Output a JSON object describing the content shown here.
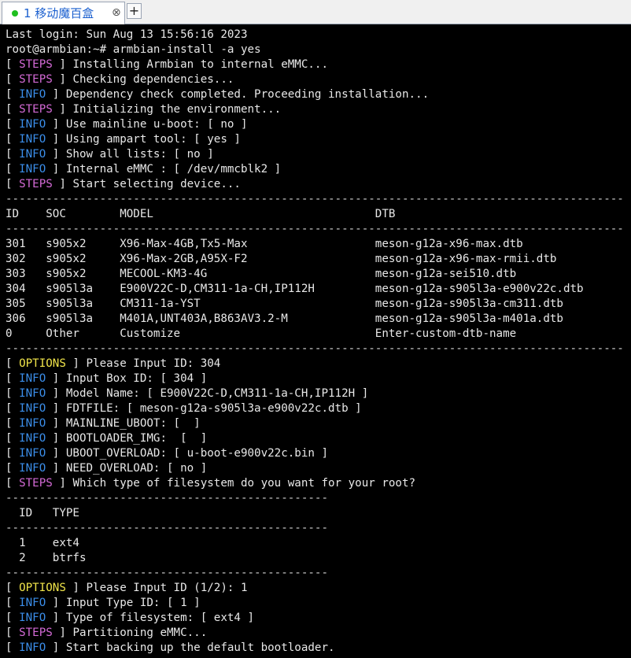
{
  "tab": {
    "label": "1 移动魔百盒",
    "close_glyph": "⊗",
    "new_tab_glyph": "+"
  },
  "terminal": {
    "lines": [
      {
        "text": "Last login: Sun Aug 13 15:56:16 2023"
      },
      {
        "text": "root@armbian:~# armbian-install -a yes"
      },
      {
        "tag": "STEPS",
        "text": "Installing Armbian to internal eMMC..."
      },
      {
        "tag": "STEPS",
        "text": "Checking dependencies..."
      },
      {
        "tag": "INFO",
        "text": "Dependency check completed. Proceeding installation..."
      },
      {
        "tag": "STEPS",
        "text": "Initializing the environment..."
      },
      {
        "tag": "INFO",
        "text": "Use mainline u-boot: [ no ]"
      },
      {
        "tag": "INFO",
        "text": "Using ampart tool: [ yes ]"
      },
      {
        "tag": "INFO",
        "text": "Show all lists: [ no ]"
      },
      {
        "tag": "INFO",
        "text": "Internal eMMC : [ /dev/mmcblk2 ]"
      },
      {
        "tag": "STEPS",
        "text": "Start selecting device..."
      },
      {
        "text": "--------------------------------------------------------------------------------------------",
        "dash": true
      },
      {
        "text": "ID    SOC        MODEL                                 DTB"
      },
      {
        "text": "--------------------------------------------------------------------------------------------",
        "dash": true
      },
      {
        "text": "301   s905x2     X96-Max-4GB,Tx5-Max                   meson-g12a-x96-max.dtb"
      },
      {
        "text": "302   s905x2     X96-Max-2GB,A95X-F2                   meson-g12a-x96-max-rmii.dtb"
      },
      {
        "text": "303   s905x2     MECOOL-KM3-4G                         meson-g12a-sei510.dtb"
      },
      {
        "text": "304   s905l3a    E900V22C-D,CM311-1a-CH,IP112H         meson-g12a-s905l3a-e900v22c.dtb"
      },
      {
        "text": "305   s905l3a    CM311-1a-YST                          meson-g12a-s905l3a-cm311.dtb"
      },
      {
        "text": "306   s905l3a    M401A,UNT403A,B863AV3.2-M             meson-g12a-s905l3a-m401a.dtb"
      },
      {
        "text": "0     Other      Customize                             Enter-custom-dtb-name"
      },
      {
        "text": "--------------------------------------------------------------------------------------------",
        "dash": true
      },
      {
        "tag": "OPTIONS",
        "text": "Please Input ID: 304"
      },
      {
        "tag": "INFO",
        "text": "Input Box ID: [ 304 ]"
      },
      {
        "tag": "INFO",
        "text": "Model Name: [ E900V22C-D,CM311-1a-CH,IP112H ]"
      },
      {
        "tag": "INFO",
        "text": "FDTFILE: [ meson-g12a-s905l3a-e900v22c.dtb ]"
      },
      {
        "tag": "INFO",
        "text": "MAINLINE_UBOOT: [  ]"
      },
      {
        "tag": "INFO",
        "text": "BOOTLOADER_IMG:  [  ]"
      },
      {
        "tag": "INFO",
        "text": "UBOOT_OVERLOAD: [ u-boot-e900v22c.bin ]"
      },
      {
        "tag": "INFO",
        "text": "NEED_OVERLOAD: [ no ]"
      },
      {
        "tag": "STEPS",
        "text": "Which type of filesystem do you want for your root?"
      },
      {
        "text": "------------------------------------------------",
        "dash": true
      },
      {
        "text": "  ID   TYPE"
      },
      {
        "text": "------------------------------------------------",
        "dash": true
      },
      {
        "text": "  1    ext4"
      },
      {
        "text": "  2    btrfs"
      },
      {
        "text": "------------------------------------------------",
        "dash": true
      },
      {
        "tag": "OPTIONS",
        "text": "Please Input ID (1/2): 1"
      },
      {
        "tag": "INFO",
        "text": "Input Type ID: [ 1 ]"
      },
      {
        "tag": "INFO",
        "text": "Type of filesystem: [ ext4 ]"
      },
      {
        "tag": "STEPS",
        "text": "Partitioning eMMC..."
      },
      {
        "tag": "INFO",
        "text": "Start backing up the default bootloader."
      }
    ]
  }
}
